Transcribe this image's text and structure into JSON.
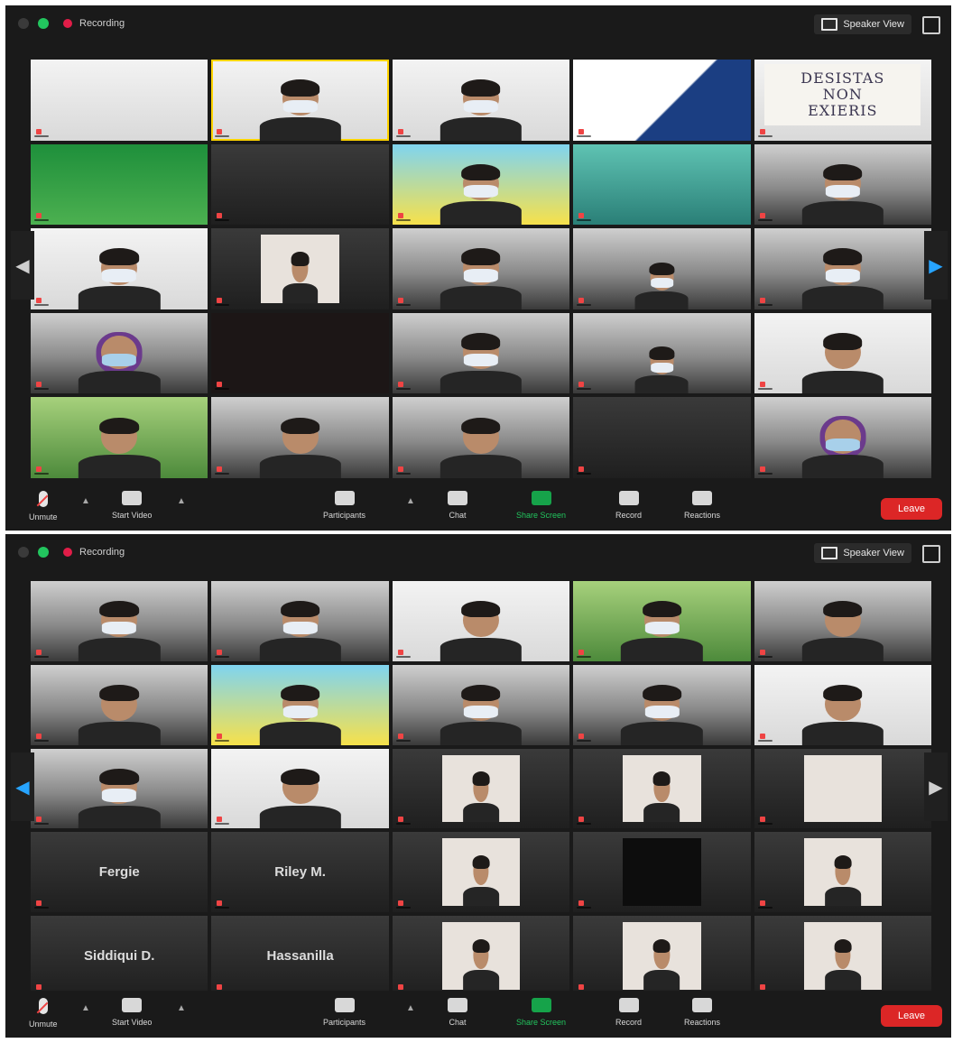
{
  "windows": [
    {
      "recording_label": "Recording",
      "speaker_view_label": "Speaker View",
      "tiles": [
        {
          "name": "",
          "scene": "bg-white",
          "kind": "slide"
        },
        {
          "name": "",
          "scene": "bg-white",
          "kind": "person-mask",
          "active": true
        },
        {
          "name": "",
          "scene": "bg-white",
          "kind": "person-mask"
        },
        {
          "name": "",
          "scene": "bg-navy",
          "kind": "slide"
        },
        {
          "name": "",
          "scene": "bg-white",
          "kind": "poster",
          "poster_lines": [
            "DESISTAS",
            "NON",
            "EXIERIS"
          ]
        },
        {
          "name": "",
          "scene": "bg-green",
          "kind": "slide"
        },
        {
          "name": "",
          "scene": "bg-dark",
          "kind": "slide"
        },
        {
          "name": "",
          "scene": "bg-blue",
          "kind": "person-mask"
        },
        {
          "name": "",
          "scene": "bg-teal",
          "kind": "slide"
        },
        {
          "name": "",
          "scene": "bg-room",
          "kind": "person-mask"
        },
        {
          "name": "",
          "scene": "bg-white",
          "kind": "person-mask"
        },
        {
          "name": "",
          "scene": "bg-dark",
          "kind": "inset"
        },
        {
          "name": "",
          "scene": "bg-room",
          "kind": "person-mask"
        },
        {
          "name": "",
          "scene": "bg-room",
          "kind": "person-small"
        },
        {
          "name": "",
          "scene": "bg-room",
          "kind": "person-mask"
        },
        {
          "name": "",
          "scene": "bg-room",
          "kind": "person-hijab"
        },
        {
          "name": "",
          "scene": "bg-black",
          "kind": "blank"
        },
        {
          "name": "",
          "scene": "bg-room",
          "kind": "person-mask"
        },
        {
          "name": "",
          "scene": "bg-room",
          "kind": "person-small"
        },
        {
          "name": "",
          "scene": "bg-white",
          "kind": "person"
        },
        {
          "name": "",
          "scene": "bg-plant",
          "kind": "person"
        },
        {
          "name": "",
          "scene": "bg-room",
          "kind": "person"
        },
        {
          "name": "",
          "scene": "bg-room",
          "kind": "person"
        },
        {
          "name": "",
          "scene": "bg-dark",
          "kind": "blank"
        },
        {
          "name": "",
          "scene": "bg-room",
          "kind": "person-hijab"
        }
      ],
      "toolbar": {
        "unmute": "Unmute",
        "start_video": "Start Video",
        "participants": "Participants",
        "chat": "Chat",
        "share_screen": "Share Screen",
        "record": "Record",
        "reactions": "Reactions",
        "leave": "Leave"
      }
    },
    {
      "recording_label": "Recording",
      "speaker_view_label": "Speaker View",
      "tiles": [
        {
          "name": "",
          "scene": "bg-room",
          "kind": "person-mask"
        },
        {
          "name": "",
          "scene": "bg-room",
          "kind": "person-mask"
        },
        {
          "name": "",
          "scene": "bg-white",
          "kind": "person"
        },
        {
          "name": "",
          "scene": "bg-plant",
          "kind": "person-mask"
        },
        {
          "name": "",
          "scene": "bg-room",
          "kind": "person"
        },
        {
          "name": "",
          "scene": "bg-room",
          "kind": "person"
        },
        {
          "name": "",
          "scene": "bg-blue",
          "kind": "person-mask"
        },
        {
          "name": "",
          "scene": "bg-room",
          "kind": "person-mask"
        },
        {
          "name": "",
          "scene": "bg-room",
          "kind": "person-mask"
        },
        {
          "name": "",
          "scene": "bg-white",
          "kind": "person"
        },
        {
          "name": "",
          "scene": "bg-room",
          "kind": "person-mask"
        },
        {
          "name": "",
          "scene": "bg-white",
          "kind": "person"
        },
        {
          "name": "",
          "scene": "bg-dark",
          "kind": "inset"
        },
        {
          "name": "",
          "scene": "bg-dark",
          "kind": "inset"
        },
        {
          "name": "",
          "scene": "bg-dark",
          "kind": "orange"
        },
        {
          "name": "",
          "scene": "bg-dark",
          "kind": "text",
          "display_name": "Fergie"
        },
        {
          "name": "",
          "scene": "bg-dark",
          "kind": "text",
          "display_name": "Riley M."
        },
        {
          "name": "",
          "scene": "bg-dark",
          "kind": "inset"
        },
        {
          "name": "",
          "scene": "bg-dark",
          "kind": "inset-black"
        },
        {
          "name": "",
          "scene": "bg-dark",
          "kind": "inset"
        },
        {
          "name": "",
          "scene": "bg-dark",
          "kind": "text",
          "display_name": "Siddiqui D."
        },
        {
          "name": "",
          "scene": "bg-dark",
          "kind": "text",
          "display_name": "Hassanilla"
        },
        {
          "name": "",
          "scene": "bg-dark",
          "kind": "inset"
        },
        {
          "name": "",
          "scene": "bg-dark",
          "kind": "inset"
        },
        {
          "name": "",
          "scene": "bg-dark",
          "kind": "inset"
        }
      ],
      "toolbar": {
        "unmute": "Unmute",
        "start_video": "Start Video",
        "participants": "Participants",
        "chat": "Chat",
        "share_screen": "Share Screen",
        "record": "Record",
        "reactions": "Reactions",
        "leave": "Leave"
      }
    }
  ]
}
